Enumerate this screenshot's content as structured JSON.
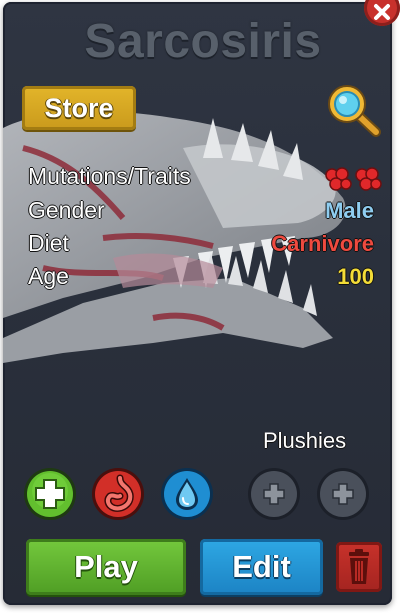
{
  "creature": {
    "name": "Sarcosiris"
  },
  "buttons": {
    "store_label": "Store",
    "play_label": "Play",
    "edit_label": "Edit"
  },
  "stats": {
    "mutations_label": "Mutations/Traits",
    "gender_label": "Gender",
    "gender_value": "Male",
    "diet_label": "Diet",
    "diet_value": "Carnivore",
    "age_label": "Age",
    "age_value": "100"
  },
  "plushies": {
    "label": "Plushies",
    "slots": [
      "empty",
      "empty"
    ]
  },
  "action_icons": [
    "add-icon",
    "stomach-icon",
    "water-drop-icon"
  ],
  "colors": {
    "panel_bg": "#2c323e",
    "store_gold": "#d4a521",
    "play_green": "#5fb22f",
    "edit_blue": "#2596d6",
    "delete_red": "#b82a24",
    "gender_male": "#8fcdf0",
    "diet_carnivore": "#ef4a3f",
    "age_yellow": "#f3dc37",
    "mutation_red": "#e0282a"
  }
}
